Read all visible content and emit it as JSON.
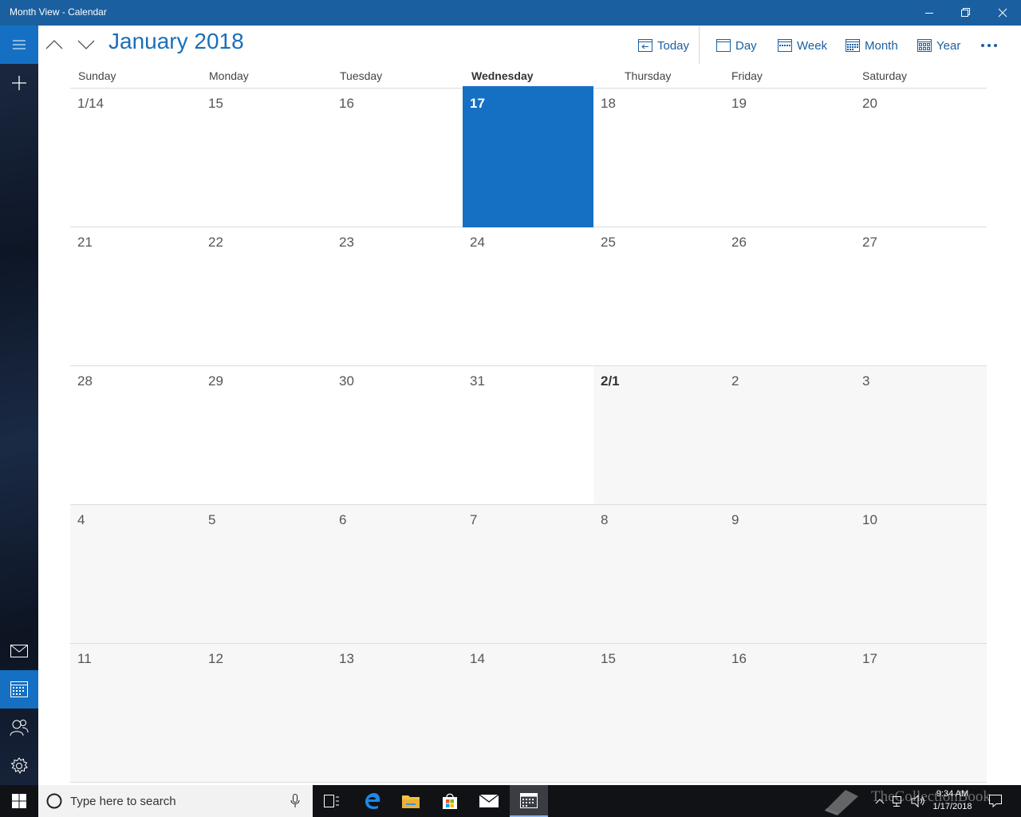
{
  "window": {
    "title": "Month View - Calendar"
  },
  "header": {
    "month_title": "January 2018",
    "buttons": {
      "today": "Today",
      "day": "Day",
      "week": "Week",
      "month": "Month",
      "year": "Year"
    }
  },
  "days_of_week": [
    "Sunday",
    "Monday",
    "Tuesday",
    "Wednesday",
    "Thursday",
    "Friday",
    "Saturday"
  ],
  "today_column": 3,
  "weeks": [
    [
      {
        "label": "1/14",
        "in_month": true
      },
      {
        "label": "15",
        "in_month": true
      },
      {
        "label": "16",
        "in_month": true
      },
      {
        "label": "17",
        "in_month": true,
        "today": true
      },
      {
        "label": "18",
        "in_month": true
      },
      {
        "label": "19",
        "in_month": true
      },
      {
        "label": "20",
        "in_month": true
      }
    ],
    [
      {
        "label": "21",
        "in_month": true
      },
      {
        "label": "22",
        "in_month": true
      },
      {
        "label": "23",
        "in_month": true
      },
      {
        "label": "24",
        "in_month": true
      },
      {
        "label": "25",
        "in_month": true
      },
      {
        "label": "26",
        "in_month": true
      },
      {
        "label": "27",
        "in_month": true
      }
    ],
    [
      {
        "label": "28",
        "in_month": true
      },
      {
        "label": "29",
        "in_month": true
      },
      {
        "label": "30",
        "in_month": true
      },
      {
        "label": "31",
        "in_month": true
      },
      {
        "label": "2/1",
        "in_month": false,
        "month_start": true
      },
      {
        "label": "2",
        "in_month": false
      },
      {
        "label": "3",
        "in_month": false
      }
    ],
    [
      {
        "label": "4",
        "in_month": false
      },
      {
        "label": "5",
        "in_month": false
      },
      {
        "label": "6",
        "in_month": false
      },
      {
        "label": "7",
        "in_month": false
      },
      {
        "label": "8",
        "in_month": false
      },
      {
        "label": "9",
        "in_month": false
      },
      {
        "label": "10",
        "in_month": false
      }
    ],
    [
      {
        "label": "11",
        "in_month": false
      },
      {
        "label": "12",
        "in_month": false
      },
      {
        "label": "13",
        "in_month": false
      },
      {
        "label": "14",
        "in_month": false
      },
      {
        "label": "15",
        "in_month": false
      },
      {
        "label": "16",
        "in_month": false
      },
      {
        "label": "17",
        "in_month": false
      }
    ]
  ],
  "taskbar": {
    "search_placeholder": "Type here to search",
    "clock_time": "9:34 AM",
    "clock_date": "1/17/2018",
    "watermark": "TheCollectionBook"
  },
  "colors": {
    "accent": "#1570c3",
    "title_bar": "#1a5fa0",
    "month_title": "#1a6fb8",
    "other_month_bg": "#f7f7f7"
  }
}
